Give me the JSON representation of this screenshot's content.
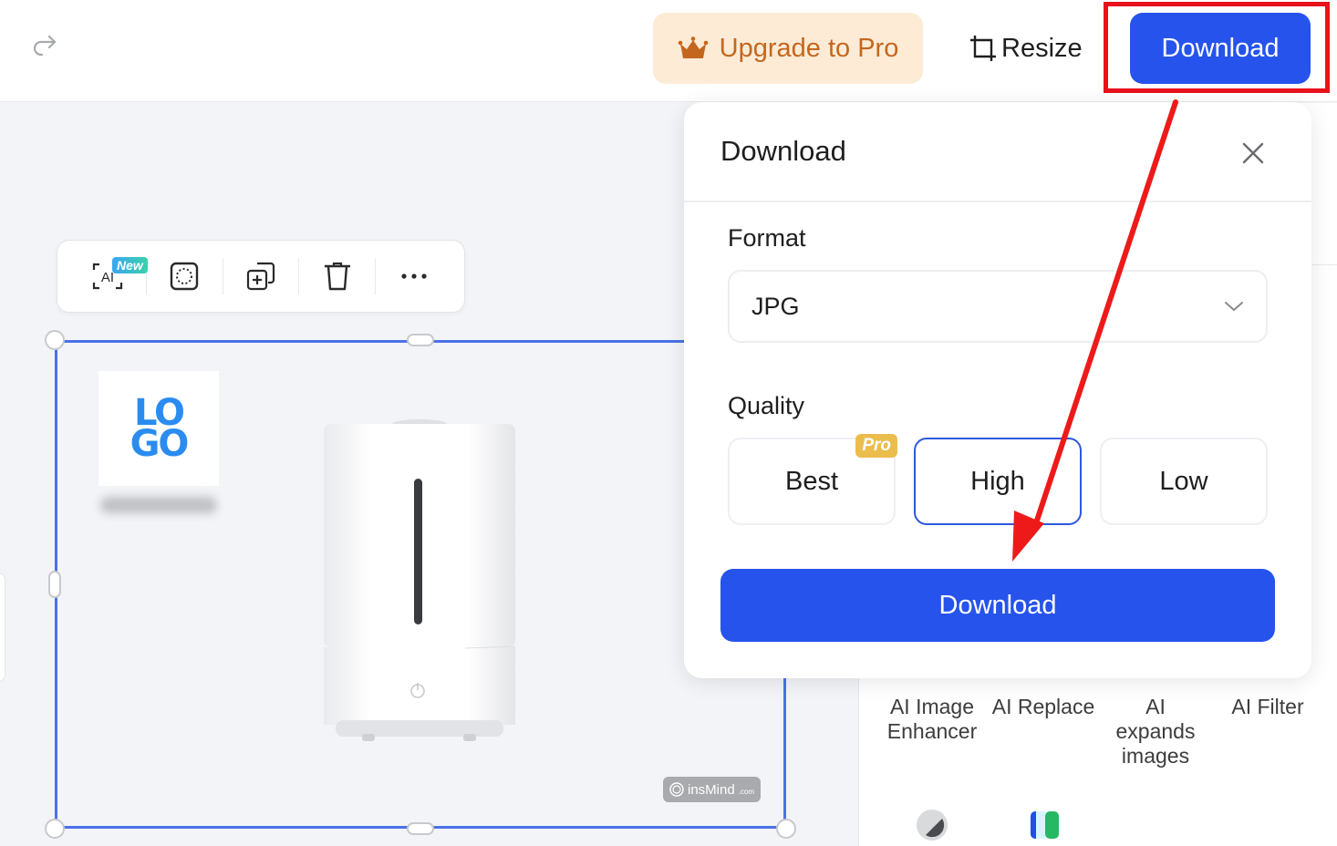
{
  "topbar": {
    "redo_icon": "redo-icon",
    "upgrade_label": "Upgrade to Pro",
    "upgrade_icon": "crown-icon",
    "resize_label": "Resize",
    "resize_icon": "crop-icon",
    "download_label": "Download"
  },
  "toolbar": {
    "items": [
      {
        "name": "ai-tool",
        "icon": "ai-scan-icon",
        "glyph": "AI",
        "badge": "New"
      },
      {
        "name": "select-tool",
        "icon": "selection-icon"
      },
      {
        "name": "duplicate-tool",
        "icon": "duplicate-icon"
      },
      {
        "name": "delete-tool",
        "icon": "trash-icon"
      },
      {
        "name": "more-tool",
        "icon": "more-icon"
      }
    ]
  },
  "canvas": {
    "logo_text_top": "LO",
    "logo_text_bottom": "GO",
    "watermark_brand": "insMind",
    "watermark_suffix": ".com"
  },
  "download_popover": {
    "title": "Download",
    "close_icon": "close-icon",
    "format_label": "Format",
    "format_value": "JPG",
    "quality_label": "Quality",
    "quality_options": [
      {
        "label": "Best",
        "badge": "Pro",
        "selected": false
      },
      {
        "label": "High",
        "selected": true
      },
      {
        "label": "Low",
        "selected": false
      }
    ],
    "download_button": "Download"
  },
  "right_panel": {
    "features": [
      {
        "label": "AI Image Enhancer"
      },
      {
        "label": "AI Replace"
      },
      {
        "label": "AI expands images"
      },
      {
        "label": "AI Filter"
      }
    ]
  },
  "colors": {
    "primary": "#2553ec",
    "upgrade_bg": "#fdebd6",
    "upgrade_text": "#c4671e",
    "selection": "#4a72e8",
    "annotation": "#e8121b",
    "pro_badge": "#ebbd4d"
  }
}
